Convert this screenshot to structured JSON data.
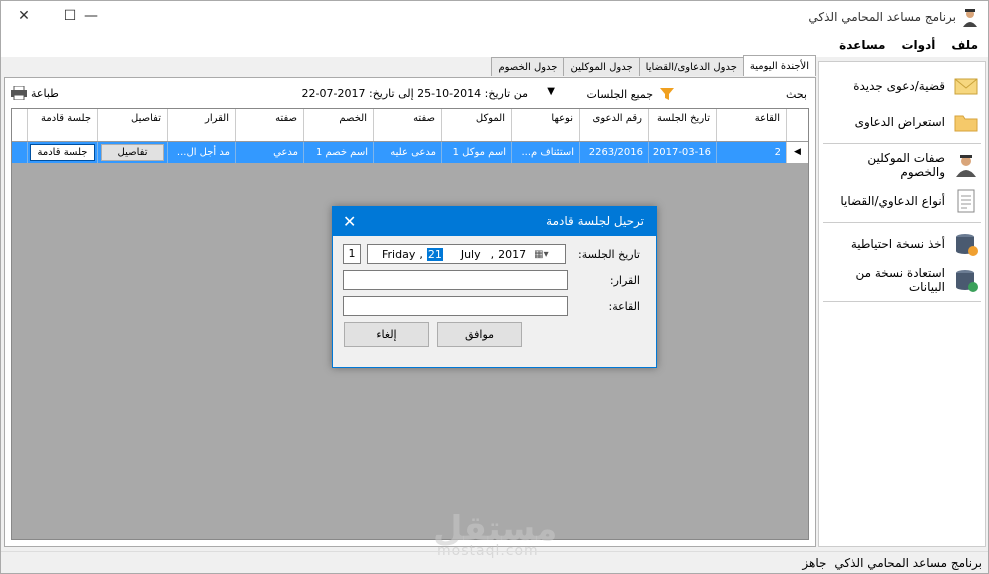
{
  "window": {
    "title": "برنامج مساعد المحامي الذكي"
  },
  "menu": [
    "ملف",
    "أدوات",
    "مساعدة"
  ],
  "sidebar": {
    "items": [
      {
        "label": "قضية/دعوى جديدة",
        "icon": "envelope-icon"
      },
      {
        "label": "استعراض الدعاوى",
        "icon": "folder-icon"
      },
      {
        "label": "صفات الموكلين والخصوم",
        "icon": "lawyer-icon"
      },
      {
        "label": "أنواع الدعاوي/القضايا",
        "icon": "document-icon"
      },
      {
        "label": "أخذ نسخة احتياطية",
        "icon": "database-backup-icon"
      },
      {
        "label": "استعادة نسخة من البيانات",
        "icon": "database-restore-icon"
      }
    ]
  },
  "tabs": [
    "الأجندة اليومية",
    "جدول الدعاوى/القضايا",
    "جدول الموكلين",
    "جدول الخصوم"
  ],
  "toolbar": {
    "search": "بحث",
    "filter": "جميع الجلسات",
    "date_range": "من تاريخ: 2014-10-25 إلى تاريخ: 2017-07-22",
    "print": "طباعة"
  },
  "grid": {
    "columns": [
      "القاعة",
      "تاريخ الجلسة",
      "رقم الدعوى",
      "نوعها",
      "الموكل",
      "صفته",
      "الخصم",
      "صفته",
      "القرار",
      "تفاصيل",
      "جلسة قادمة"
    ],
    "rows": [
      [
        "2",
        "2017-03-16",
        "2263/2016",
        "استئناف م...",
        "اسم موكل 1",
        "مدعى عليه",
        "اسم خصم 1",
        "مدعي",
        "مد أجل ال...",
        "تفاصيل",
        "جلسة قادمة"
      ]
    ]
  },
  "dialog": {
    "title": "ترحيل لجلسة قادمة",
    "date_label": "تاريخ الجلسة:",
    "date_weekday": "Friday",
    "date_day": "21",
    "date_month": "July",
    "date_year": "2017",
    "spinner": "1",
    "decision_label": "القرار:",
    "hall_label": "القاعة:",
    "ok": "موافق",
    "cancel": "إلغاء"
  },
  "status": {
    "state": "جاهز",
    "app": "برنامج مساعد المحامي الذكي"
  },
  "watermark": {
    "arabic": "مستقل",
    "latin": "mostaql.com"
  },
  "colors": {
    "accent": "#0078d7",
    "selection": "#3399ff"
  }
}
